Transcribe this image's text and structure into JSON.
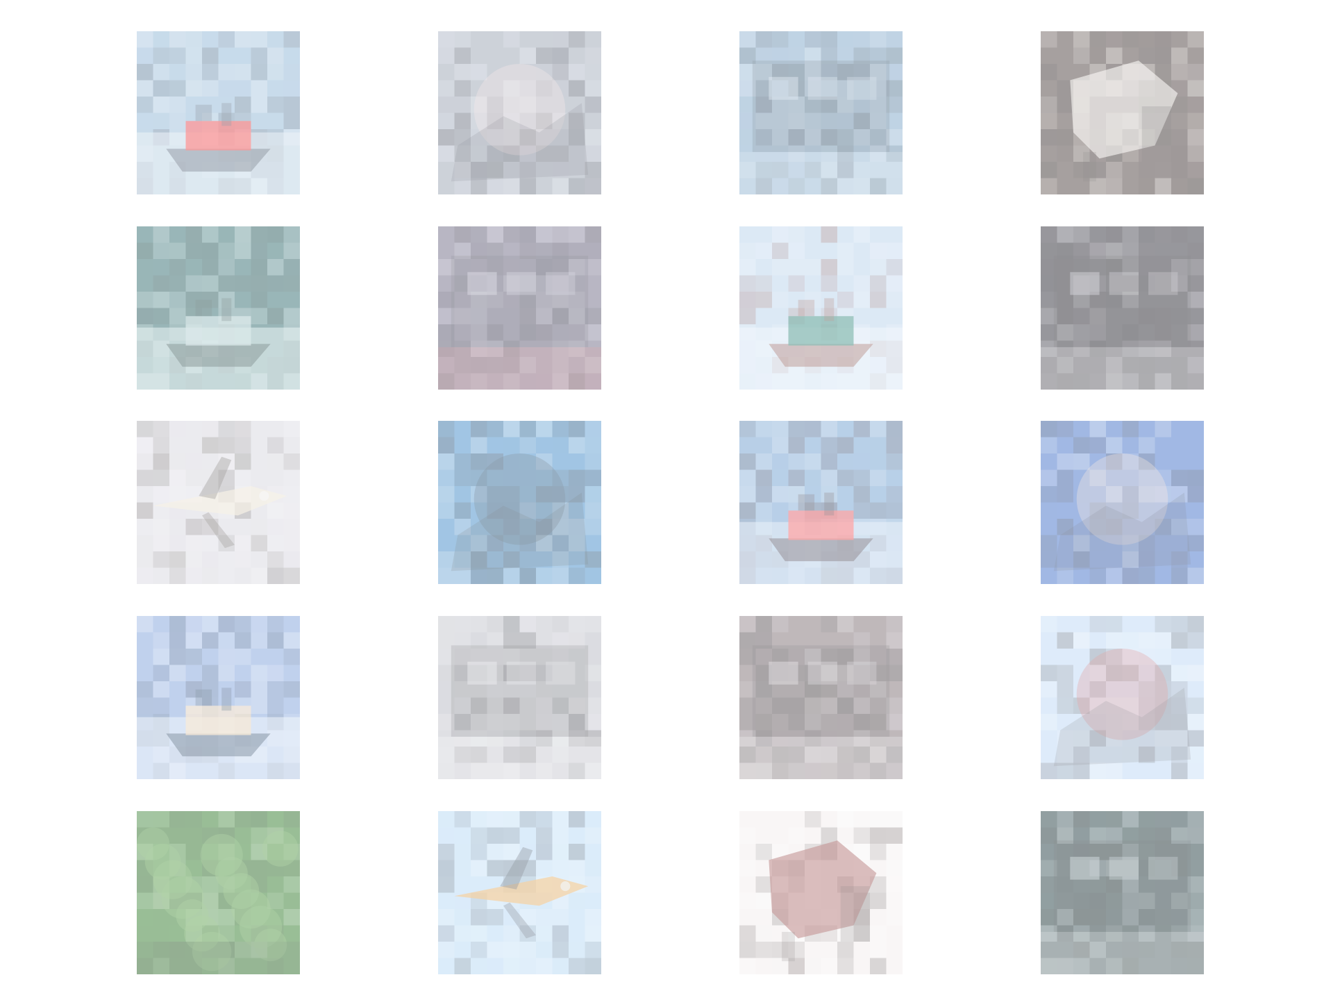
{
  "gallery": {
    "rows": 5,
    "cols": 4,
    "tiles": [
      {
        "row": 0,
        "col": 0,
        "subject": "red-boat-on-water",
        "bg": "#8fb6d6",
        "accent": "#ff2b2b",
        "dark": "#2c3b4f",
        "light": "#dfe9f2"
      },
      {
        "row": 0,
        "col": 1,
        "subject": "bird-over-landscape",
        "bg": "#9aa3b3",
        "accent": "#f1d6d6",
        "dark": "#1e2430",
        "light": "#dfe8f3"
      },
      {
        "row": 0,
        "col": 2,
        "subject": "harbor-with-masts",
        "bg": "#7ea6c8",
        "accent": "#d7e6f5",
        "dark": "#0f2232",
        "light": "#cfe0f1"
      },
      {
        "row": 0,
        "col": 3,
        "subject": "white-animal-closeup",
        "bg": "#4a3d3b",
        "accent": "#f7f2ee",
        "dark": "#1b1616",
        "light": "#e9e2dc"
      },
      {
        "row": 1,
        "col": 0,
        "subject": "ship-in-teal-water",
        "bg": "#2e6a6d",
        "accent": "#b7d4d6",
        "dark": "#173435",
        "light": "#d8ecef"
      },
      {
        "row": 1,
        "col": 1,
        "subject": "busy-street-scene",
        "bg": "#6f6a85",
        "accent": "#c34b4b",
        "dark": "#1f2233",
        "light": "#c8c8da"
      },
      {
        "row": 1,
        "col": 2,
        "subject": "ship-with-green-deck",
        "bg": "#b9d3ec",
        "accent": "#1a7b69",
        "dark": "#7d3a32",
        "light": "#e6f0fb"
      },
      {
        "row": 1,
        "col": 3,
        "subject": "dark-vehicle-interior",
        "bg": "#2c2a35",
        "accent": "#f2f2f2",
        "dark": "#0f0f14",
        "light": "#bdbdc7"
      },
      {
        "row": 2,
        "col": 0,
        "subject": "white-airplane-on-ground",
        "bg": "#d7d6df",
        "accent": "#efe6cf",
        "dark": "#3c3631",
        "light": "#f1f1f7"
      },
      {
        "row": 2,
        "col": 1,
        "subject": "blue-sea-map-like",
        "bg": "#3f8ac8",
        "accent": "#0f2c44",
        "dark": "#0b1520",
        "light": "#d9e7f2"
      },
      {
        "row": 2,
        "col": 2,
        "subject": "colorful-ship-underwater",
        "bg": "#6f9fd0",
        "accent": "#ff4a4a",
        "dark": "#2a1f2c",
        "light": "#d8e6f5"
      },
      {
        "row": 2,
        "col": 3,
        "subject": "abstract-blue-orange",
        "bg": "#3f6ec8",
        "accent": "#f6d8c3",
        "dark": "#14213a",
        "light": "#e6eef9"
      },
      {
        "row": 3,
        "col": 0,
        "subject": "boat-blue-sky",
        "bg": "#7fa1dc",
        "accent": "#f4d8b2",
        "dark": "#0f2b4a",
        "light": "#e6f0fb"
      },
      {
        "row": 3,
        "col": 1,
        "subject": "white-vehicle-street",
        "bg": "#b7b9c2",
        "accent": "#ffffff",
        "dark": "#1e1f25",
        "light": "#e6e7ee"
      },
      {
        "row": 3,
        "col": 2,
        "subject": "man-near-vehicle",
        "bg": "#7c6e73",
        "accent": "#ffffff",
        "dark": "#1b1a1e",
        "light": "#d7d0d6"
      },
      {
        "row": 3,
        "col": 3,
        "subject": "reflection-bright-sky",
        "bg": "#bcd8f6",
        "accent": "#c84848",
        "dark": "#2a2b31",
        "light": "#f2f8ff"
      },
      {
        "row": 4,
        "col": 0,
        "subject": "dense-green-trees",
        "bg": "#2e7a28",
        "accent": "#5fa54b",
        "dark": "#173a18",
        "light": "#b9d7b3"
      },
      {
        "row": 4,
        "col": 1,
        "subject": "colorful-airplane-sky",
        "bg": "#b7d9f5",
        "accent": "#f0a23d",
        "dark": "#1f2c3b",
        "light": "#e8f5ff"
      },
      {
        "row": 4,
        "col": 2,
        "subject": "brown-animal-white-bg",
        "bg": "#f4efef",
        "accent": "#8b2b2b",
        "dark": "#2b1f1f",
        "light": "#ffffff"
      },
      {
        "row": 4,
        "col": 3,
        "subject": "building-with-awning",
        "bg": "#1f3a3e",
        "accent": "#d9d9d9",
        "dark": "#0b1416",
        "light": "#bfd1d8"
      }
    ]
  }
}
